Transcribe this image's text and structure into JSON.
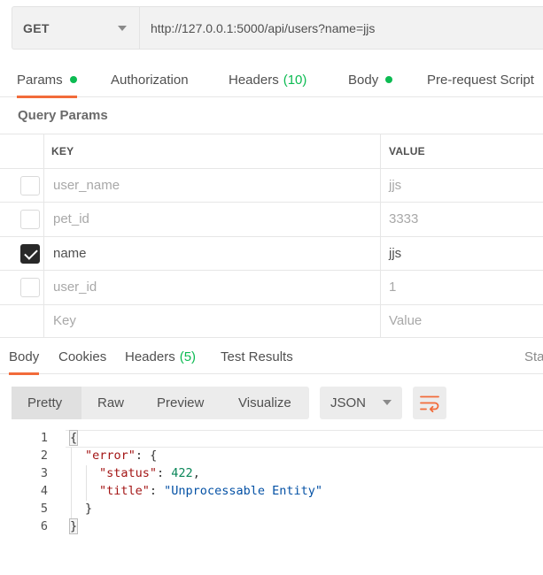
{
  "request": {
    "method": "GET",
    "url": "http://127.0.0.1:5000/api/users?name=jjs"
  },
  "request_tabs": {
    "params": "Params",
    "authorization": "Authorization",
    "headers": "Headers",
    "headers_count": "(10)",
    "body": "Body",
    "prerequest": "Pre-request Script"
  },
  "query_params": {
    "title": "Query Params",
    "key_header": "KEY",
    "value_header": "VALUE",
    "rows": [
      {
        "key": "user_name",
        "value": "jjs",
        "checked": false
      },
      {
        "key": "pet_id",
        "value": "3333",
        "checked": false
      },
      {
        "key": "name",
        "value": "jjs",
        "checked": true
      },
      {
        "key": "user_id",
        "value": "1",
        "checked": false
      }
    ],
    "key_placeholder": "Key",
    "value_placeholder": "Value"
  },
  "response_tabs": {
    "body": "Body",
    "cookies": "Cookies",
    "headers": "Headers",
    "headers_count": "(5)",
    "test_results": "Test Results",
    "status_partial": "Sta"
  },
  "format": {
    "pretty": "Pretty",
    "raw": "Raw",
    "preview": "Preview",
    "visualize": "Visualize",
    "language": "JSON"
  },
  "response_body": {
    "line_numbers": [
      "1",
      "2",
      "3",
      "4",
      "5",
      "6"
    ],
    "open_brace": "{",
    "error_key": "\"error\"",
    "error_open": ": {",
    "status_key": "\"status\"",
    "status_value": "422",
    "title_key": "\"title\"",
    "title_value": "\"Unprocessable Entity\"",
    "inner_close": "}",
    "close_brace": "}"
  },
  "colors": {
    "accent": "#f26b3a",
    "count_green": "#0cbb52"
  }
}
